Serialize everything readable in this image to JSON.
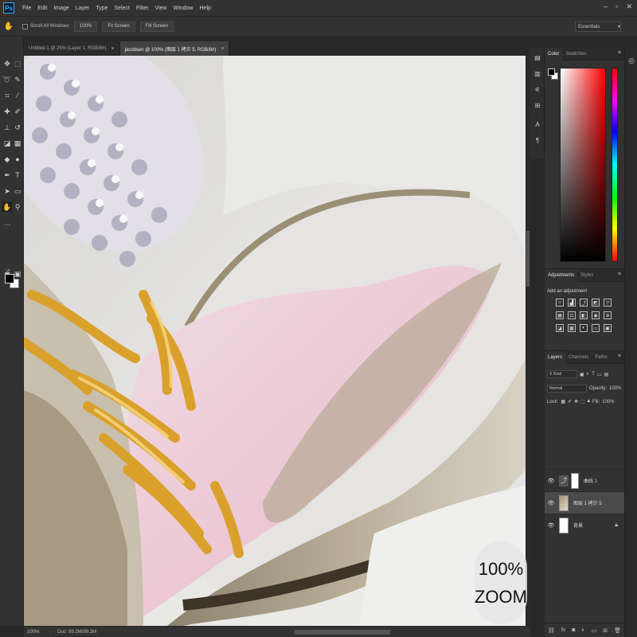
{
  "app": {
    "logo": "Ps"
  },
  "menu": [
    "File",
    "Edit",
    "Image",
    "Layer",
    "Type",
    "Select",
    "Filter",
    "View",
    "Window",
    "Help"
  ],
  "window_controls": [
    "–",
    "▫",
    "✕"
  ],
  "options_bar": {
    "scroll_all_windows": "Scroll All Windows",
    "zoom_button": "100%",
    "fit_screen": "Fit Screen",
    "fill_screen": "Fill Screen",
    "workspace": "Essentials"
  },
  "tabs": [
    {
      "label": "Untitled-1 @ 25% (Layer 1, RGB/8#)"
    },
    {
      "label": "jacobsen @ 100% (图层 1 拷贝 5, RGB/8#)"
    }
  ],
  "tab_close": "×",
  "status_bar": {
    "zoom": "100%",
    "doc": "Doc: 99.2M/99.2M"
  },
  "zoom_badge": {
    "line1": "100%",
    "line2": "ZOOM"
  },
  "color_panel": {
    "tabs": [
      "Color",
      "Swatches"
    ],
    "fg_color": "#000000",
    "bg_color": "#ffffff"
  },
  "adjustments_panel": {
    "tabs": [
      "Adjustments",
      "Styles"
    ],
    "title": "Add an adjustment"
  },
  "layers_panel": {
    "tabs": [
      "Layers",
      "Channels",
      "Paths"
    ],
    "kind": "Kind",
    "blend_mode": "Normal",
    "opacity_label": "Opacity:",
    "opacity_value": "100%",
    "lock_label": "Lock:",
    "fill_label": "Fill:",
    "fill_value": "100%",
    "layers": [
      {
        "name": "曲线 1",
        "visible": true,
        "type": "adjustment"
      },
      {
        "name": "图层 1 拷贝 5",
        "visible": true,
        "type": "image",
        "selected": true
      },
      {
        "name": "背景",
        "visible": true,
        "type": "background",
        "locked": true
      }
    ]
  },
  "icons": {
    "hand_tool": "hand-icon",
    "menu": "menu-icon"
  }
}
